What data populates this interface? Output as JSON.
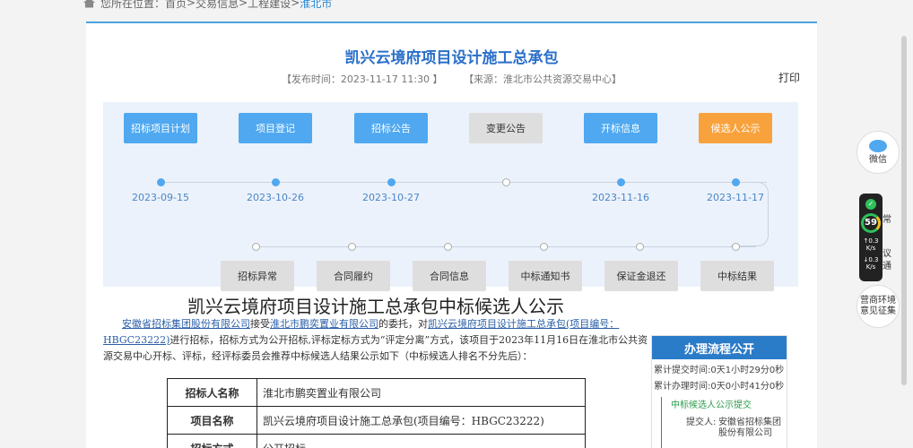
{
  "breadcrumb": {
    "prefix": "您所在位置：",
    "items": [
      "首页",
      "交易信息",
      "工程建设"
    ],
    "sep": " > ",
    "current": "淮北市"
  },
  "header": {
    "title": "凯兴云境府项目设计施工总承包",
    "publish": "【发布时间：2023-11-17 11:30 】",
    "source": "【来源：淮北市公共资源交易中心】",
    "print": "打印"
  },
  "flow": {
    "top": [
      {
        "label": "招标项目计划",
        "state": "blue",
        "date": "2023-09-15",
        "dot": "fill"
      },
      {
        "label": "项目登记",
        "state": "blue",
        "date": "2023-10-26",
        "dot": "fill"
      },
      {
        "label": "招标公告",
        "state": "blue",
        "date": "2023-10-27",
        "dot": "fill"
      },
      {
        "label": "变更公告",
        "state": "gray",
        "date": "",
        "dot": "hollow"
      },
      {
        "label": "开标信息",
        "state": "blue",
        "date": "2023-11-16",
        "dot": "fill"
      },
      {
        "label": "候选人公示",
        "state": "orange",
        "date": "2023-11-17",
        "dot": "fill"
      }
    ],
    "bottom": [
      "招标异常",
      "合同履约",
      "合同信息",
      "中标通知书",
      "保证金退还",
      "中标结果"
    ]
  },
  "notice": {
    "heading": "凯兴云境府项目设计施工总承包中标候选人公示",
    "agent": "安徽省招标集团股份有限公司",
    "t1": "接受",
    "owner": "淮北市鹏奕置业有限公司",
    "t2": "的委托，对",
    "project_ref": "凯兴云境府项目设计施工总承包(项目编号：HBGC23222)",
    "t3": "进行招标，招标方式为公开招标,评标定标方式为“评定分离”方式，该项目于2023年11月16日在淮北市公共资源交易中心开标、评标，经评标委员会推荐中标候选人结果公示如下（中标候选人排名不分先后）："
  },
  "table": [
    {
      "k": "招标人名称",
      "v": "淮北市鹏奕置业有限公司"
    },
    {
      "k": "项目名称",
      "v": "凯兴云境府项目设计施工总承包(项目编号：HBGC23222)"
    },
    {
      "k": "招标方式",
      "v": "公开招标"
    }
  ],
  "process": {
    "title": "办理流程公开",
    "total_label": "累计提交时间:",
    "total_value": "0天1小时29分0秒",
    "handle_label": "累计办理时间:",
    "handle_value": "0天0小时41分0秒",
    "step": "中标候选人公示提交",
    "submitter_label": "提交人:",
    "submitter": "安徽省招标集团股份有限公司"
  },
  "floating": {
    "wechat": "微信",
    "env": "营商环境意见征集",
    "peek1": "常",
    "peek2": "议",
    "peek3": "通"
  },
  "widget": {
    "score": "59",
    "up": "0.3",
    "down": "0.3",
    "unit": "K/s"
  }
}
